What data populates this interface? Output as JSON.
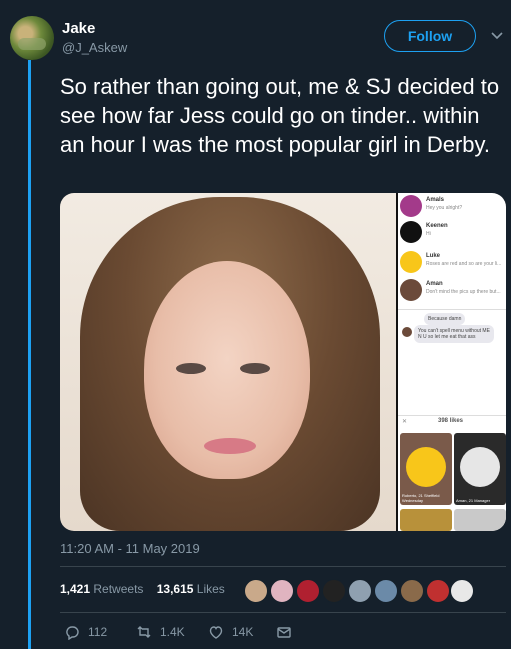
{
  "user": {
    "name": "Jake",
    "handle": "@J_Askew",
    "follow_label": "Follow"
  },
  "tweet": {
    "text": "So rather than going out, me & SJ decided to see how far Jess could go on tinder.. within an hour I was the most popular girl in Derby.",
    "timestamp": "11:20 AM - 11 May 2019"
  },
  "media": {
    "chats": [
      {
        "name": "Amals",
        "message": "Hey you alright?"
      },
      {
        "name": "Keenen",
        "message": "Hi"
      },
      {
        "name": "Luke",
        "message": "Roses are red and so are your li..."
      },
      {
        "name": "Aman",
        "message": "Don't mind the pics up there but..."
      }
    ],
    "bubble_1": "Because damn",
    "bubble_2": "You can't spell menu without ME N U so let me eat that ass",
    "x_label": "✕",
    "likes_label": "398 likes",
    "card_1_label": "Roberto, 21 Sheffield Wednesday",
    "card_2_label": "Aman, 21 Manager"
  },
  "stats": {
    "retweets_count": "1,421",
    "retweets_label": "Retweets",
    "likes_count": "13,615",
    "likes_label": "Likes"
  },
  "actions": {
    "reply_count": "112",
    "retweet_count": "1.4K",
    "like_count": "14K"
  },
  "colors": {
    "accent": "#1da1f2",
    "background": "#15202b",
    "muted": "#8899a6"
  }
}
